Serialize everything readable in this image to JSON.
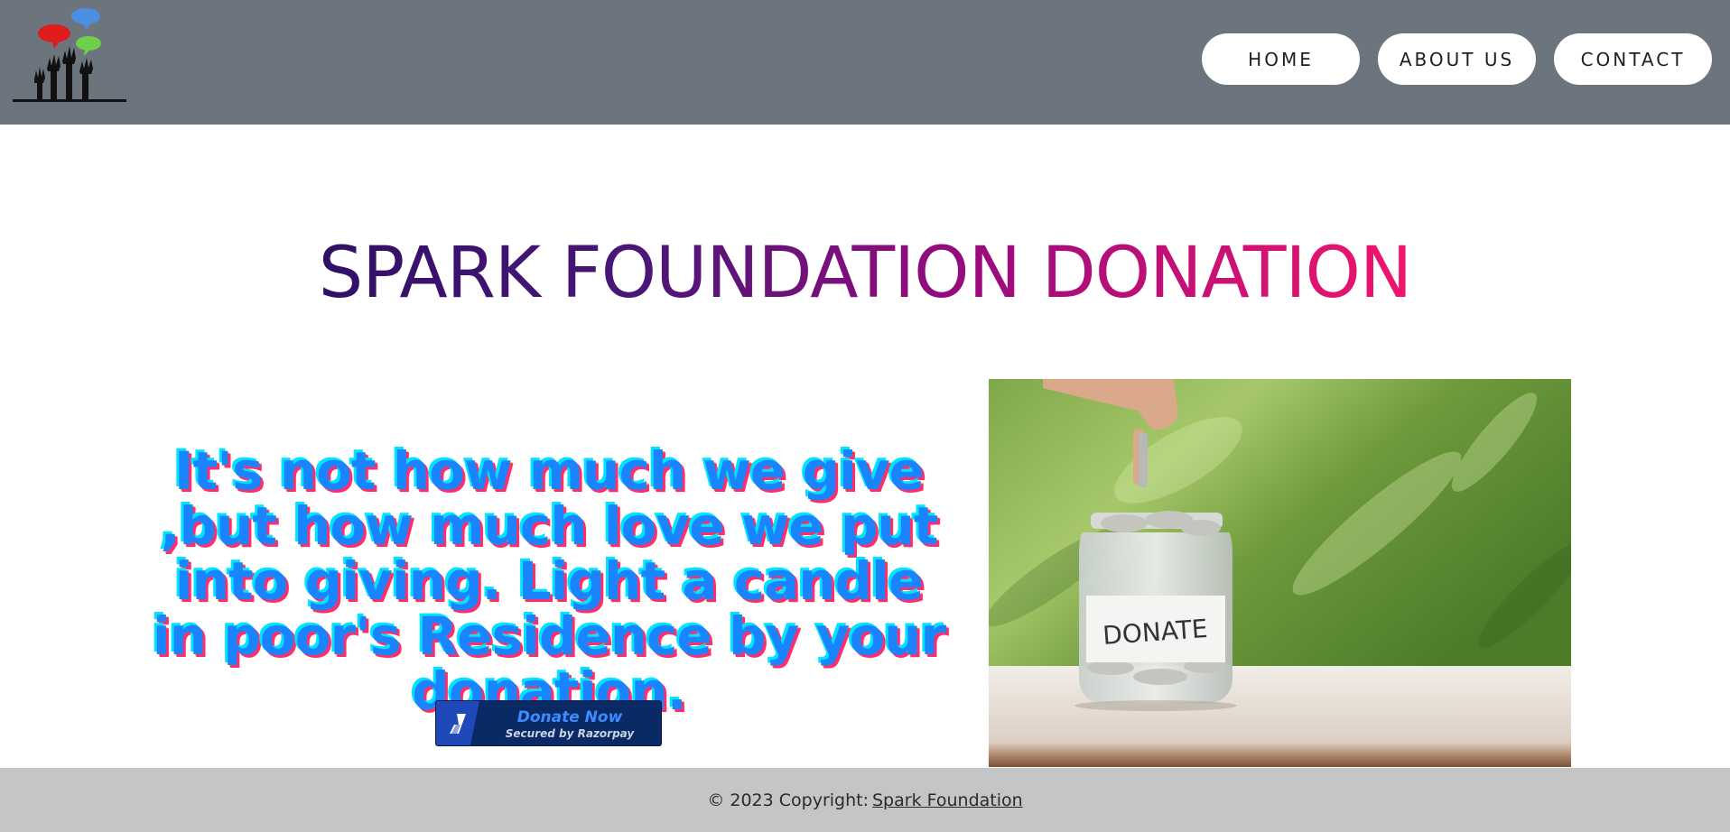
{
  "header": {
    "logo_icon": "raised-hands-speech-bubbles-logo",
    "background": "#6c757d",
    "nav": [
      {
        "label": "HOME"
      },
      {
        "label": "ABOUT US"
      },
      {
        "label": "CONTACT"
      }
    ]
  },
  "main": {
    "title": "SPARK FOUNDATION DONATION",
    "quote": "It's not how much we give ,but how much love we put into giving. Light a candle in poor's Residence by your donation.",
    "donate_button": {
      "label": "Donate Now",
      "sublabel": "Secured by Razorpay",
      "icon": "razorpay-icon"
    },
    "image": {
      "jar_label": "DONATE"
    }
  },
  "footer": {
    "copyright_prefix": "© 2023 Copyright:",
    "link_text": "Spark Foundation"
  },
  "colors": {
    "title_gradient_start": "#2e1065",
    "title_gradient_end": "#f5166b",
    "quote_color": "#1a84ff",
    "footer_bg": "#c4c5c7",
    "donate_bg": "#0a2a66"
  }
}
